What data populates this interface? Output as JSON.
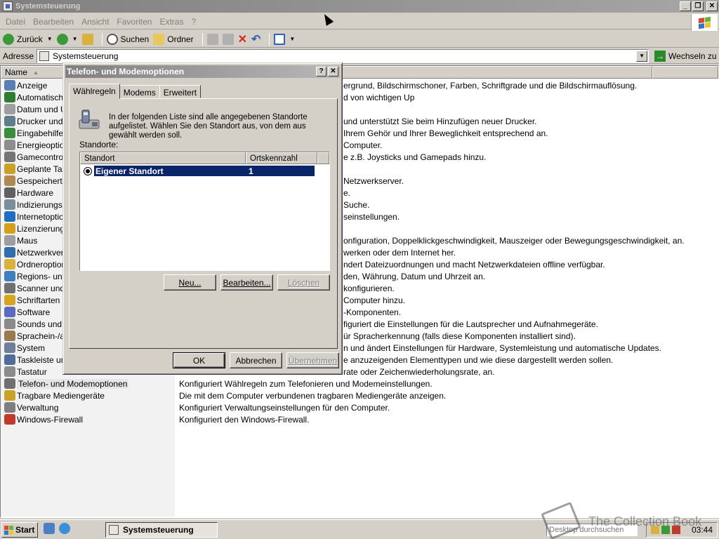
{
  "window": {
    "title": "Systemsteuerung",
    "controls": [
      "_",
      "❐",
      "✕"
    ]
  },
  "menu": [
    "Datei",
    "Bearbeiten",
    "Ansicht",
    "Favoriten",
    "Extras",
    "?"
  ],
  "toolbar": {
    "back": "Zurück",
    "search": "Suchen",
    "folders": "Ordner"
  },
  "address": {
    "label": "Adresse",
    "value": "Systemsteuerung",
    "go": "Wechseln zu"
  },
  "columns": {
    "name": "Name"
  },
  "items": [
    {
      "name": "Anzeige",
      "desc": "ergrund, Bildschirmschoner, Farben, Schriftgrade und die Bildschirmauflösung.",
      "partial": true,
      "color": "#5b7fb5"
    },
    {
      "name": "Automatische",
      "desc": "d von wichtigen Up",
      "partial": true,
      "color": "#2e7d32"
    },
    {
      "name": "Datum und Uh",
      "desc": "",
      "partial": true,
      "color": "#9e9e9e"
    },
    {
      "name": "Drucker und F",
      "desc": "und unterstützt Sie beim Hinzufügen neuer Drucker.",
      "partial": true,
      "color": "#607d8b"
    },
    {
      "name": "Eingabehilfen",
      "desc": " Ihrem Gehör und Ihrer Beweglichkeit entsprechend an.",
      "partial": true,
      "color": "#388e3c"
    },
    {
      "name": "Energieoption",
      "desc": "Computer.",
      "partial": true,
      "color": "#8d8d8d"
    },
    {
      "name": "Gamecontrolle",
      "desc": "e z.B. Joysticks und Gamepads hinzu.",
      "partial": true,
      "color": "#757575"
    },
    {
      "name": "Geplante Task",
      "desc": "",
      "partial": true,
      "color": "#c9a227"
    },
    {
      "name": "Gespeicherte",
      "desc": " Netzwerkserver.",
      "partial": true,
      "color": "#b08850"
    },
    {
      "name": "Hardware",
      "desc": "e.",
      "partial": true,
      "color": "#616161"
    },
    {
      "name": "Indizierungso",
      "desc": " Suche.",
      "partial": true,
      "color": "#78909c"
    },
    {
      "name": "Internetoptio",
      "desc": "seinstellungen.",
      "partial": true,
      "color": "#1e6fc1"
    },
    {
      "name": "Lizenzierung",
      "desc": "",
      "partial": true,
      "color": "#d4a017"
    },
    {
      "name": "Maus",
      "desc": "onfiguration, Doppelklickgeschwindigkeit, Mauszeiger oder Bewegungsgeschwindigkeit, an.",
      "partial": true,
      "color": "#9e9e9e"
    },
    {
      "name": "Netzwerkverb",
      "desc": "werken oder dem Internet her.",
      "partial": true,
      "color": "#2f6fb0"
    },
    {
      "name": "Ordneroption",
      "desc": "ndert Dateizuordnungen und macht Netzwerkdateien offline verfügbar.",
      "partial": true,
      "color": "#d9b13b"
    },
    {
      "name": "Regions- und",
      "desc": "den, Währung, Datum und Uhrzeit an.",
      "partial": true,
      "color": "#3f7fbf"
    },
    {
      "name": "Scanner und I",
      "desc": "konfigurieren.",
      "partial": true,
      "color": "#707070"
    },
    {
      "name": "Schriftarten",
      "desc": "Computer hinzu.",
      "partial": true,
      "color": "#d6a61e"
    },
    {
      "name": "Software",
      "desc": "-Komponenten.",
      "partial": true,
      "color": "#5c6bc0"
    },
    {
      "name": "Sounds und A",
      "desc": "figuriert die Einstellungen für die Lautsprecher und Aufnahmegeräte.",
      "partial": true,
      "color": "#8a8a8a"
    },
    {
      "name": "Sprachein-/au",
      "desc": "ür Spracherkennung (falls diese Komponenten installiert sind).",
      "partial": true,
      "color": "#9a7b4f"
    },
    {
      "name": "System",
      "desc": "n und ändert Einstellungen für Hardware, Systemleistung und automatische Updates.",
      "partial": true,
      "color": "#6d7f99"
    },
    {
      "name": "Taskleiste und",
      "desc": "e anzuzeigenden Elementtypen und wie diese dargestellt werden sollen.",
      "partial": true,
      "color": "#4f6d9a"
    },
    {
      "name": "Tastatur",
      "desc": "rate oder Zeichenwiederholungsrate, an.",
      "partial": true,
      "color": "#8c8c8c"
    },
    {
      "name": "Telefon- und Modemoptionen",
      "desc": "Konfiguriert Wählregeln zum Telefonieren und Modemeinstellungen.",
      "partial": false,
      "selected": true,
      "color": "#707070"
    },
    {
      "name": "Tragbare Mediengeräte",
      "desc": "Die mit dem Computer verbundenen tragbaren Mediengeräte anzeigen.",
      "partial": false,
      "color": "#c9a227"
    },
    {
      "name": "Verwaltung",
      "desc": "Konfiguriert Verwaltungseinstellungen für den Computer.",
      "partial": false,
      "color": "#7f7f7f"
    },
    {
      "name": "Windows-Firewall",
      "desc": "Konfiguriert den Windows-Firewall.",
      "partial": false,
      "color": "#c0392b"
    }
  ],
  "dialog": {
    "title": "Telefon- und Modemoptionen",
    "help": "?",
    "close": "✕",
    "tabs": [
      "Wählregeln",
      "Modems",
      "Erweitert"
    ],
    "intro": "In der folgenden Liste sind alle angegebenen Standorte aufgelistet. Wählen Sie den Standort aus, von dem aus gewählt werden soll.",
    "locations_label": "Standorte:",
    "col_location": "Standort",
    "col_areacode": "Ortskennzahl",
    "row": {
      "location": "Eigener Standort",
      "areacode": "1"
    },
    "btn_new": "Neu...",
    "btn_edit": "Bearbeiten...",
    "btn_delete": "Löschen",
    "btn_ok": "OK",
    "btn_cancel": "Abbrechen",
    "btn_apply": "Übernehmen"
  },
  "taskbar": {
    "start": "Start",
    "task": "Systemsteuerung",
    "search_placeholder": "Desktop durchsuchen",
    "clock": "03:44"
  },
  "watermark": "The Collection Book"
}
